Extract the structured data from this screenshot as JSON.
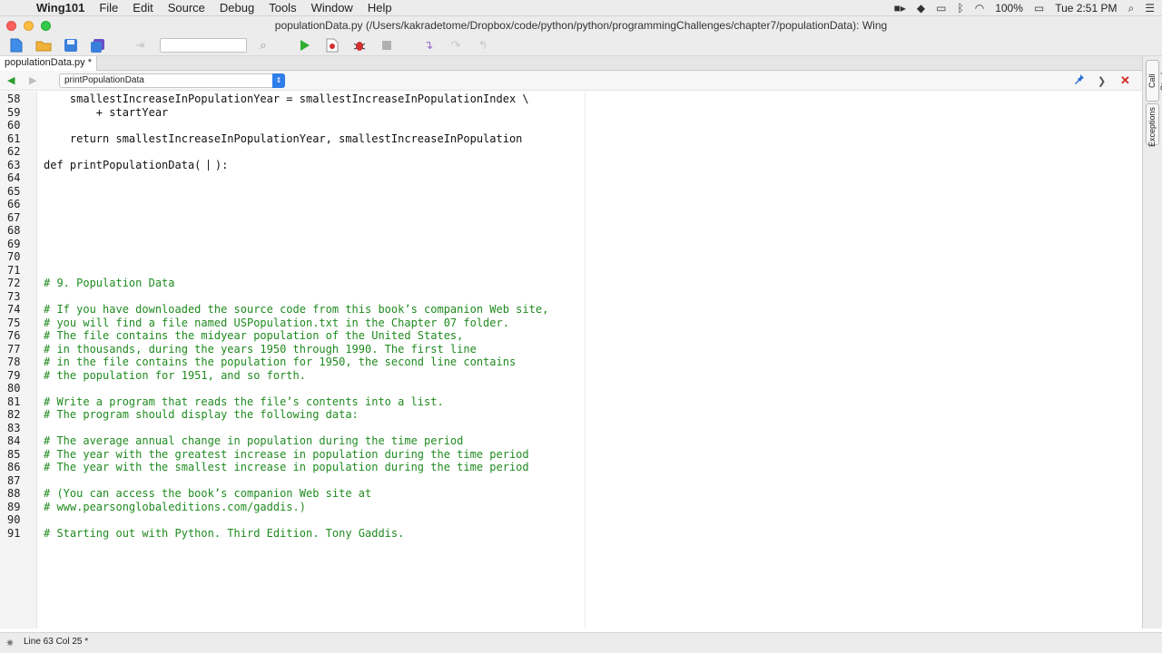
{
  "menubar": {
    "apple_symbol": "",
    "app_name": "Wing101",
    "menus": [
      "File",
      "Edit",
      "Source",
      "Debug",
      "Tools",
      "Window",
      "Help"
    ],
    "battery": "100%",
    "clock": "Tue 2:51 PM"
  },
  "window": {
    "title": "populationData.py (/Users/kakradetome/Dropbox/code/python/python/programmingChallenges/chapter7/populationData): Wing"
  },
  "tabs": [
    {
      "label": "populationData.py *"
    }
  ],
  "navbar": {
    "scope_selected": "printPopulationData",
    "scope_arrow": "⇕"
  },
  "side_tabs": [
    "Call Stack",
    "Exceptions"
  ],
  "editor": {
    "lines": [
      {
        "n": "58",
        "text": "    smallestIncreaseInPopulationYear = smallestIncreaseInPopulationIndex \\",
        "kind": "code"
      },
      {
        "n": "59",
        "text": "        + startYear",
        "kind": "code"
      },
      {
        "n": "60",
        "text": "",
        "kind": "code"
      },
      {
        "n": "61",
        "text": "    return smallestIncreaseInPopulationYear, smallestIncreaseInPopulation",
        "kind": "code"
      },
      {
        "n": "62",
        "text": "",
        "kind": "code"
      },
      {
        "n": "63",
        "text": "def printPopulationData( ",
        "kind": "def",
        "after_cursor": " ):"
      },
      {
        "n": "64",
        "text": "",
        "kind": "code"
      },
      {
        "n": "65",
        "text": "",
        "kind": "code"
      },
      {
        "n": "66",
        "text": "",
        "kind": "code"
      },
      {
        "n": "67",
        "text": "",
        "kind": "code"
      },
      {
        "n": "68",
        "text": "",
        "kind": "code"
      },
      {
        "n": "69",
        "text": "",
        "kind": "code"
      },
      {
        "n": "70",
        "text": "",
        "kind": "code"
      },
      {
        "n": "71",
        "text": "",
        "kind": "code"
      },
      {
        "n": "72",
        "text": "# 9. Population Data",
        "kind": "comment"
      },
      {
        "n": "73",
        "text": "",
        "kind": "code"
      },
      {
        "n": "74",
        "text": "# If you have downloaded the source code from this book’s companion Web site,",
        "kind": "comment"
      },
      {
        "n": "75",
        "text": "# you will find a file named USPopulation.txt in the Chapter 07 folder.",
        "kind": "comment"
      },
      {
        "n": "76",
        "text": "# The file contains the midyear population of the United States,",
        "kind": "comment"
      },
      {
        "n": "77",
        "text": "# in thousands, during the years 1950 through 1990. The first line",
        "kind": "comment"
      },
      {
        "n": "78",
        "text": "# in the file contains the population for 1950, the second line contains",
        "kind": "comment"
      },
      {
        "n": "79",
        "text": "# the population for 1951, and so forth.",
        "kind": "comment"
      },
      {
        "n": "80",
        "text": "",
        "kind": "code"
      },
      {
        "n": "81",
        "text": "# Write a program that reads the file’s contents into a list.",
        "kind": "comment"
      },
      {
        "n": "82",
        "text": "# The program should display the following data:",
        "kind": "comment"
      },
      {
        "n": "83",
        "text": "",
        "kind": "code"
      },
      {
        "n": "84",
        "text": "# The average annual change in population during the time period",
        "kind": "comment"
      },
      {
        "n": "85",
        "text": "# The year with the greatest increase in population during the time period",
        "kind": "comment"
      },
      {
        "n": "86",
        "text": "# The year with the smallest increase in population during the time period",
        "kind": "comment"
      },
      {
        "n": "87",
        "text": "",
        "kind": "code"
      },
      {
        "n": "88",
        "text": "# (You can access the book’s companion Web site at",
        "kind": "comment"
      },
      {
        "n": "89",
        "text": "# www.pearsonglobaleditions.com/gaddis.)",
        "kind": "comment"
      },
      {
        "n": "90",
        "text": "",
        "kind": "code"
      },
      {
        "n": "91",
        "text": "# Starting out with Python. Third Edition. Tony Gaddis.",
        "kind": "comment"
      }
    ]
  },
  "statusbar": {
    "position": "Line 63 Col 25 *"
  },
  "colors": {
    "comment": "#1f8a1f",
    "run_button": "#2fae2f",
    "close_editor": "#d0281f",
    "scope_arrow_bg": "#2f7dea"
  }
}
